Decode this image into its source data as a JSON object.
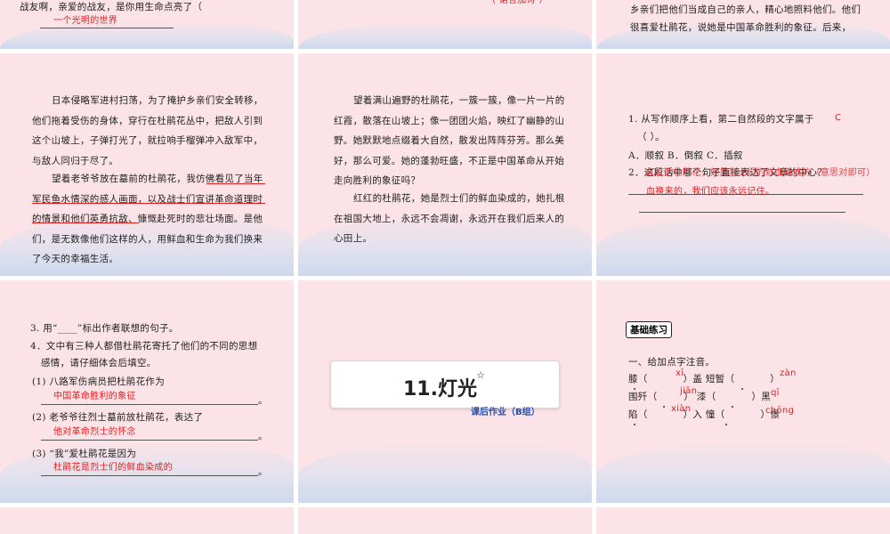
{
  "slides": {
    "s1": {
      "line1": "战友啊，亲爱的战友，是你用生命点亮了（",
      "answer": "一个光明的世界"
    },
    "s2": {
      "answer": "（  诺言加诗  ）"
    },
    "s3": {
      "line1": "乡亲们把他们当成自己的亲人，精心地照料他们。他们",
      "line2": "很喜爱杜鹃花，说她是中国革命胜利的象征。后来，"
    },
    "s4": {
      "p1": [
        "日本侵略军进村扫荡，为了掩护乡亲们安全转移，",
        "他们拖着受伤的身体，穿行在杜鹃花丛中，把敌人引到",
        "这个山坡上，子弹打光了，就拉响手榴弹冲入敌军中，",
        "与敌人同归于尽了。"
      ],
      "p2": [
        "望着老爷爷放在墓前的杜鹃花，我仿佛看见了当年",
        "军民鱼水情深的感人画面，以及战士们宣讲革命道理时",
        "的情景和他们英勇抗敌、慷慨赴死时的悲壮场面。是他",
        "们，是无数像他们这样的人，用鲜血和生命为我们换来",
        "了今天的幸福生活。"
      ]
    },
    "s5": {
      "p1": [
        "望着满山遍野的杜鹃花，一簇一簇，像一片一片的",
        "红霞，散落在山坡上；像一团团火焰，映红了幽静的山",
        "野。她默默地点缀着大自然，散发出阵阵芬芳。那么美",
        "好，那么可爱。她的蓬勃旺盛，不正是中国革命从开始",
        "走向胜利的象征吗？"
      ],
      "p2": [
        "红红的杜鹃花，她是烈士们的鲜血染成的，她扎根",
        "在祖国大地上，永远不会凋谢，永远开在我们后来人的",
        "心田上。"
      ]
    },
    "s6": {
      "q1": "1.  从写作顺序上看，第二自然段的文字属于",
      "q1_answer": "C",
      "q1_paren": "（        ）。",
      "opts": "A．顺叙          B．倒叙          C．插叙",
      "q2": "2．这段话中哪个句子直接表达了文章的中心？",
      "q2_answer_line1": "红红的杜鹃花，她是烈士们的鲜血染成的（意思对即可）",
      "q2_answer_line2": "血换来的，我们应该永远记住。"
    },
    "s7": {
      "q3": "3.  用“____”标出作者联想的句子。",
      "q4a": "4．文中有三种人都借杜鹃花寄托了他们的不同的思想",
      "q4b": "感情，请仔细体会后填空。",
      "i1": "(1) 八路军伤病员把杜鹃花作为",
      "a1": "中国革命胜利的象征",
      "i2": "(2) 老爷爷往烈士墓前放杜鹃花，表达了",
      "a2": "他对革命烈士的怀念",
      "i3": "(3) “我”爱杜鹃花是因为",
      "a3": "杜鹃花是烈士们的鲜血染成的",
      "end": "。"
    },
    "s8": {
      "title": "11.灯光",
      "star": "☆",
      "tag": "课后作业（B组）"
    },
    "s9": {
      "badge": "基础练习",
      "heading": "一、给加点字注音。",
      "r1a": "膝（",
      "r1a_ans": "xī",
      "r1b": "）盖    短暂（",
      "r1b_ans": "zàn",
      "r1c": "）",
      "r2a": "围歼（",
      "r2a_ans": "jiān",
      "r2b": "）    漆（",
      "r2b_ans": "qī",
      "r2c": "）黑",
      "r3a": "陷（",
      "r3a_ans": "xiàn",
      "r3b": "）入    憧（",
      "r3b_ans": "chōng",
      "r3c": "）憬"
    }
  }
}
